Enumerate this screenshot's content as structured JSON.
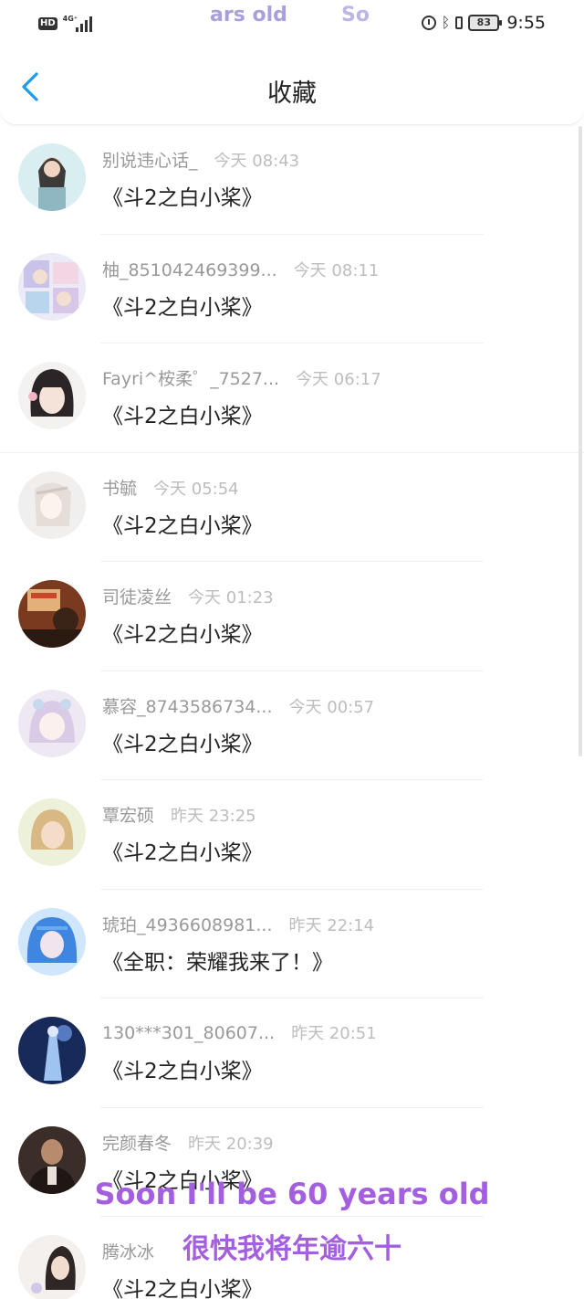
{
  "status_bar": {
    "hd": "HD",
    "network": "4G⁺",
    "ticker_left": "ars old",
    "ticker_right": "So",
    "battery": "83",
    "time": "9:55"
  },
  "header": {
    "title": "收藏"
  },
  "items": [
    {
      "name": "别说违心话_",
      "time": "今天 08:43",
      "title": "《斗2之白小桨》"
    },
    {
      "name": "柚_851042469399...",
      "time": "今天 08:11",
      "title": "《斗2之白小桨》"
    },
    {
      "name": "Fayri^桉柔゜_7527...",
      "time": "今天 06:17",
      "title": "《斗2之白小桨》"
    },
    {
      "name": "书毓",
      "time": "今天 05:54",
      "title": "《斗2之白小桨》"
    },
    {
      "name": "司徒凌丝",
      "time": "今天 01:23",
      "title": "《斗2之白小桨》"
    },
    {
      "name": "慕容_8743586734...",
      "time": "今天 00:57",
      "title": "《斗2之白小桨》"
    },
    {
      "name": "覃宏硕",
      "time": "昨天 23:25",
      "title": "《斗2之白小桨》"
    },
    {
      "name": "琥珀_4936608981...",
      "time": "昨天 22:14",
      "title": "《全职：荣耀我来了！》"
    },
    {
      "name": "130***301_80607...",
      "time": "昨天 20:51",
      "title": "《斗2之白小桨》"
    },
    {
      "name": "完颜春冬",
      "time": "昨天 20:39",
      "title": "《斗2之白小桨》"
    },
    {
      "name": "腾冰冰",
      "time": "",
      "title": "《斗2之白小桨》"
    }
  ],
  "overlay": {
    "english": "Soon I'll be 60 years old",
    "chinese": "很快我将年逾六十"
  },
  "colors": {
    "accent": "#1e9bea",
    "overlay": "#a45fe0"
  }
}
